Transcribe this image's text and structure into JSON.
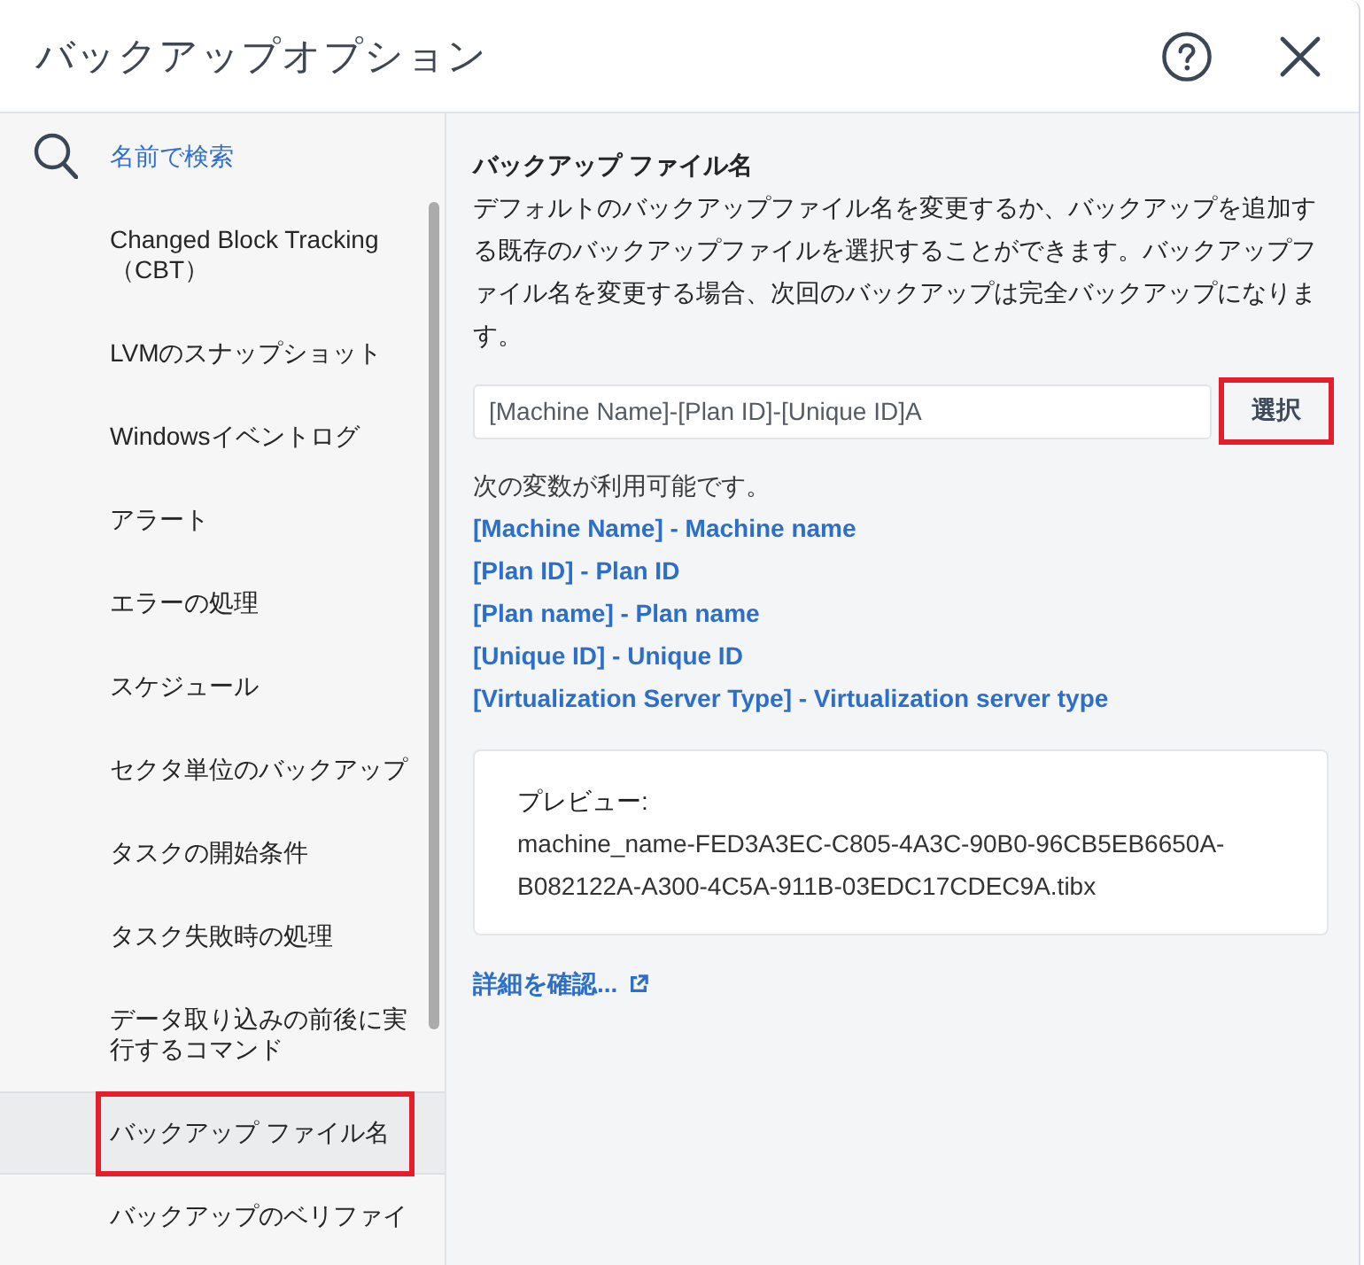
{
  "window": {
    "title": "バックアップオプション"
  },
  "sidebar": {
    "search": {
      "placeholder": "名前で検索"
    },
    "items": [
      {
        "label": "Changed Block Tracking（CBT）",
        "selected": false,
        "highlighted": false
      },
      {
        "label": "LVMのスナップショット",
        "selected": false,
        "highlighted": false
      },
      {
        "label": "Windowsイベントログ",
        "selected": false,
        "highlighted": false
      },
      {
        "label": "アラート",
        "selected": false,
        "highlighted": false
      },
      {
        "label": "エラーの処理",
        "selected": false,
        "highlighted": false
      },
      {
        "label": "スケジュール",
        "selected": false,
        "highlighted": false
      },
      {
        "label": "セクタ単位のバックアップ",
        "selected": false,
        "highlighted": false
      },
      {
        "label": "タスクの開始条件",
        "selected": false,
        "highlighted": false
      },
      {
        "label": "タスク失敗時の処理",
        "selected": false,
        "highlighted": false
      },
      {
        "label": "データ取り込みの前後に実行するコマンド",
        "selected": false,
        "highlighted": false
      },
      {
        "label": "バックアップ ファイル名",
        "selected": true,
        "highlighted": true
      },
      {
        "label": "バックアップのベリファイ",
        "selected": false,
        "highlighted": false
      }
    ]
  },
  "content": {
    "title": "バックアップ ファイル名",
    "description": "デフォルトのバックアップファイル名を変更するか、バックアップを追加する既存のバックアップファイルを選択することができます。バックアップファイル名を変更する場合、次回のバックアップは完全バックアップになります。",
    "file_name_field": {
      "value": "[Machine Name]-[Plan ID]-[Unique ID]A"
    },
    "select_button": {
      "label": "選択",
      "highlighted": true
    },
    "variables_intro": "次の変数が利用可能です。",
    "variables": [
      "[Machine Name] - Machine name",
      "[Plan ID] - Plan ID",
      "[Plan name] - Plan name",
      "[Unique ID] - Unique ID",
      "[Virtualization Server Type] - Virtualization server type"
    ],
    "preview": {
      "label": "プレビュー:",
      "value": "machine_name-FED3A3EC-C805-4A3C-90B0-96CB5EB6650A-B082122A-A300-4C5A-911B-03EDC17CDEC9A.tibx"
    },
    "more_link": {
      "label": "詳細を確認...",
      "external": true
    }
  }
}
